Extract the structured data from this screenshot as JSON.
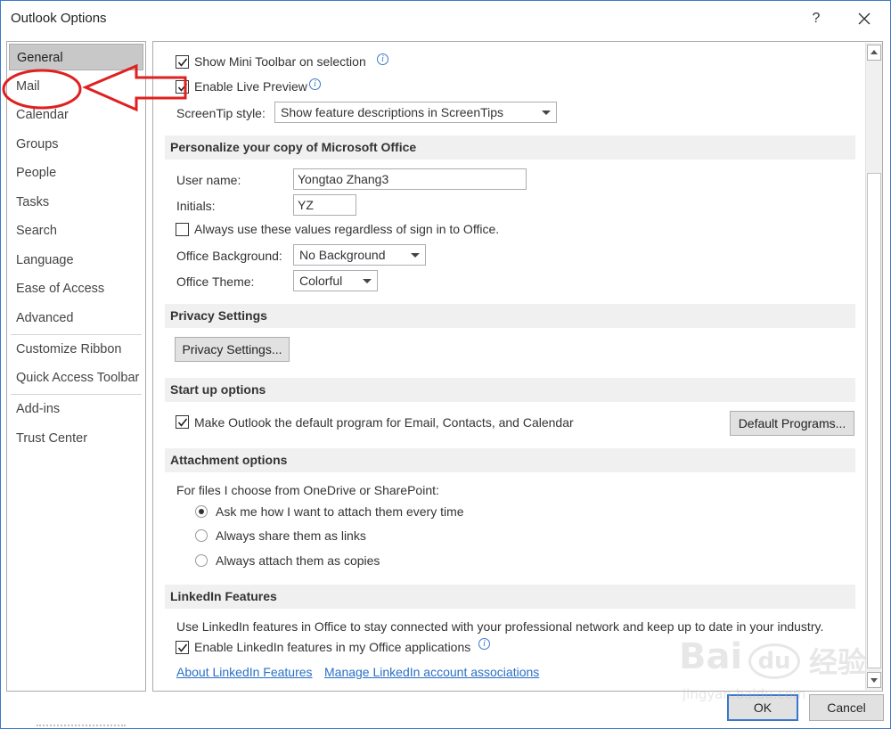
{
  "window": {
    "title": "Outlook Options",
    "help_glyph": "?"
  },
  "nav": {
    "items": [
      "General",
      "Mail",
      "Calendar",
      "Groups",
      "People",
      "Tasks",
      "Search",
      "Language",
      "Ease of Access",
      "Advanced",
      "Customize Ribbon",
      "Quick Access Toolbar",
      "Add-ins",
      "Trust Center"
    ],
    "selected": "General"
  },
  "general": {
    "mini_toolbar": {
      "label": "Show Mini Toolbar on selection",
      "checked": true
    },
    "live_preview": {
      "label": "Enable Live Preview",
      "checked": true
    },
    "screentip": {
      "label": "ScreenTip style:",
      "value": "Show feature descriptions in ScreenTips"
    }
  },
  "personalize": {
    "heading": "Personalize your copy of Microsoft Office",
    "username_label": "User name:",
    "username_value": "Yongtao Zhang3",
    "initials_label": "Initials:",
    "initials_value": "YZ",
    "always_use": {
      "label": "Always use these values regardless of sign in to Office.",
      "checked": false
    },
    "background_label": "Office Background:",
    "background_value": "No Background",
    "theme_label": "Office Theme:",
    "theme_value": "Colorful"
  },
  "privacy": {
    "heading": "Privacy Settings",
    "button": "Privacy Settings..."
  },
  "startup": {
    "heading": "Start up options",
    "default_program": {
      "label": "Make Outlook the default program for Email, Contacts, and Calendar",
      "checked": true
    },
    "button": "Default Programs..."
  },
  "attachment": {
    "heading": "Attachment options",
    "intro": "For files I choose from OneDrive or SharePoint:",
    "options": [
      "Ask me how I want to attach them every time",
      "Always share them as links",
      "Always attach them as copies"
    ],
    "selected_index": 0
  },
  "linkedin": {
    "heading": "LinkedIn Features",
    "description": "Use LinkedIn features in Office to stay connected with your professional network and keep up to date in your industry.",
    "enable": {
      "label": "Enable LinkedIn features in my Office applications",
      "checked": true
    },
    "links": [
      "About LinkedIn Features",
      "Manage LinkedIn account associations"
    ]
  },
  "footer": {
    "ok": "OK",
    "cancel": "Cancel"
  },
  "watermark": {
    "brand": "Bai",
    "brand2": "du",
    "cn": "经验",
    "url": "jingyan.baidu.com"
  },
  "colors": {
    "accent": "#3a77cc",
    "annotation": "#e02020",
    "section_bg": "#f0f0f0",
    "link": "#2a6fc4"
  }
}
